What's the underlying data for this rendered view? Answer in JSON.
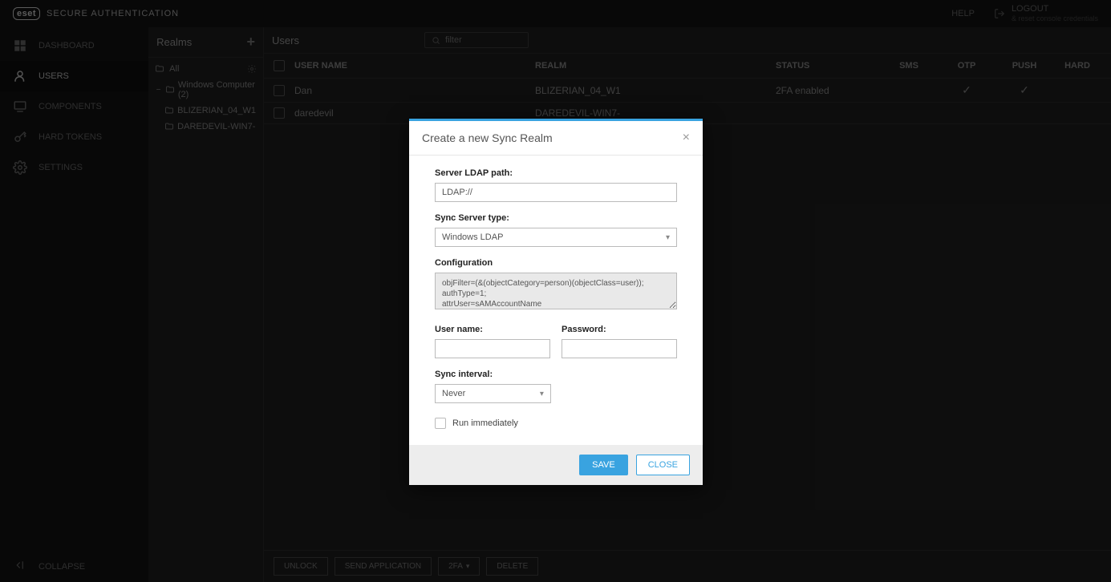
{
  "brand": {
    "logo": "eset",
    "text": "SECURE AUTHENTICATION"
  },
  "topbar": {
    "help": "HELP",
    "logout": "LOGOUT",
    "logout_sub": "& reset console credentials"
  },
  "sidebar": {
    "items": [
      {
        "label": "DASHBOARD"
      },
      {
        "label": "USERS"
      },
      {
        "label": "COMPONENTS"
      },
      {
        "label": "HARD TOKENS"
      },
      {
        "label": "SETTINGS"
      }
    ],
    "collapse": "COLLAPSE"
  },
  "realms": {
    "title": "Realms",
    "all": "All",
    "root": "Windows Computer (2)",
    "children": [
      "BLIZERIAN_04_W1",
      "DAREDEVIL-WIN7-"
    ]
  },
  "users": {
    "title": "Users",
    "search_placeholder": "filter",
    "columns": {
      "user": "USER NAME",
      "realm": "REALM",
      "status": "STATUS",
      "sms": "SMS",
      "otp": "OTP",
      "push": "PUSH",
      "hard": "HARD"
    },
    "rows": [
      {
        "user": "Dan",
        "realm": "BLIZERIAN_04_W1",
        "status": "2FA enabled",
        "sms": "",
        "otp": "✓",
        "push": "✓",
        "hard": ""
      },
      {
        "user": "daredevil",
        "realm": "DAREDEVIL-WIN7-",
        "status": "",
        "sms": "",
        "otp": "",
        "push": "",
        "hard": ""
      }
    ],
    "footer": {
      "unlock": "UNLOCK",
      "send": "SEND APPLICATION",
      "twofa": "2FA",
      "delete": "DELETE"
    }
  },
  "modal": {
    "title": "Create a new Sync Realm",
    "labels": {
      "ldap": "Server LDAP path:",
      "type": "Sync Server type:",
      "config": "Configuration",
      "username": "User name:",
      "password": "Password:",
      "interval": "Sync interval:",
      "run": "Run immediately"
    },
    "values": {
      "ldap": "LDAP://",
      "type": "Windows LDAP",
      "config": "objFilter=(&(objectCategory=person)(objectClass=user));\nauthType=1;\nattrUser=sAMAccountName",
      "username": "",
      "password": "",
      "interval": "Never"
    },
    "buttons": {
      "save": "SAVE",
      "close": "CLOSE"
    }
  }
}
